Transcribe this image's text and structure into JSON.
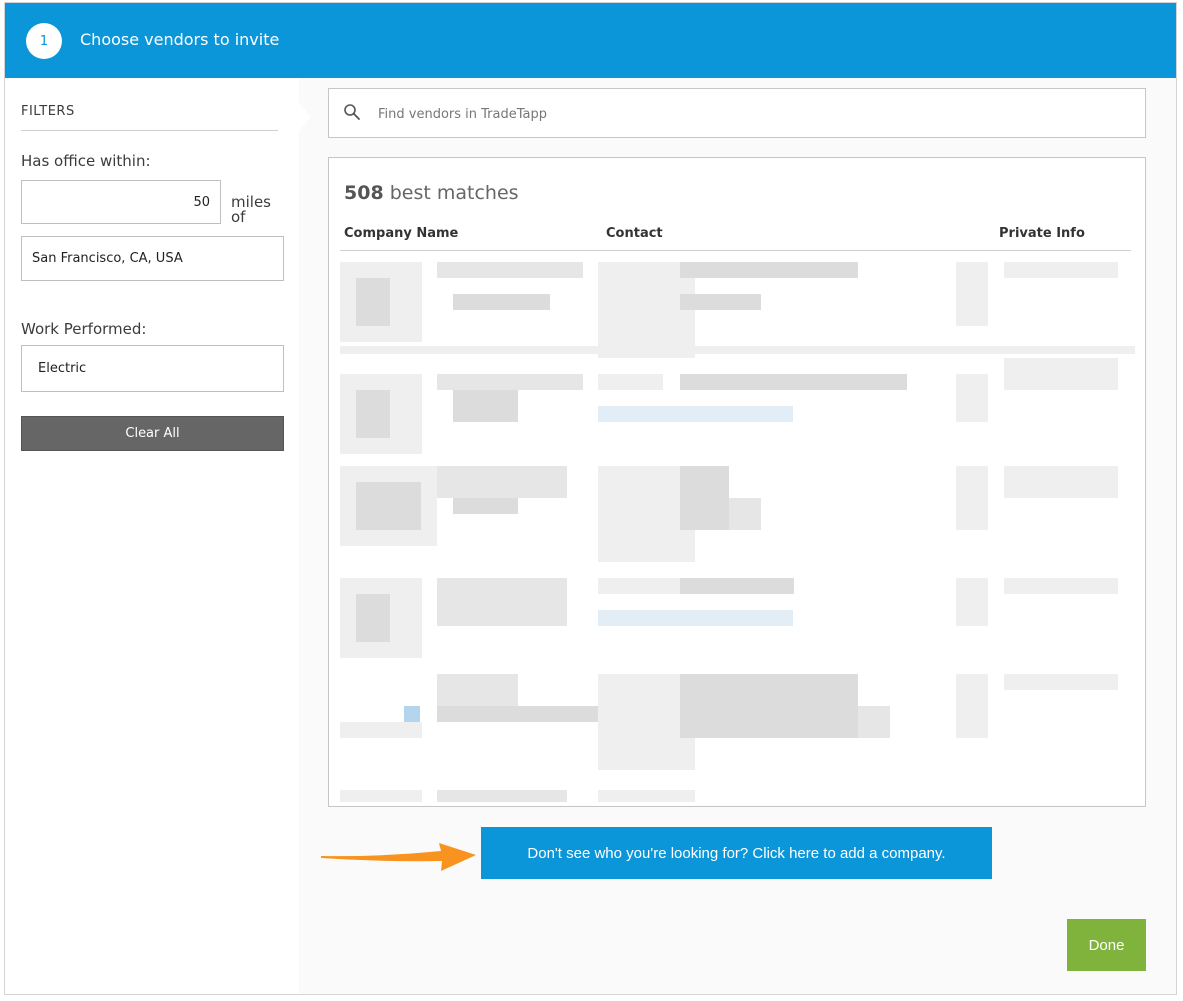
{
  "header": {
    "step_number": "1",
    "title": "Choose vendors to invite"
  },
  "filters": {
    "title": "FILTERS",
    "office_label": "Has office within:",
    "distance_value": "50",
    "distance_unit": "miles of",
    "location_value": "San Francisco, CA, USA",
    "work_label": "Work Performed:",
    "work_value": "Electric",
    "clear_label": "Clear All"
  },
  "search": {
    "placeholder": "Find vendors in TradeTapp",
    "icon": "search-icon"
  },
  "results": {
    "count": "508",
    "count_suffix": "best matches",
    "columns": [
      "Company Name",
      "Contact",
      "Private Info"
    ],
    "rows_blurred": true
  },
  "actions": {
    "add_company_label": "Don't see who you're looking for? Click here to add a company.",
    "done_label": "Done"
  },
  "colors": {
    "header": "#0a96d8",
    "add_button": "#0a96d8",
    "done_button": "#80b33c",
    "clear_button": "#666666",
    "arrow": "#f7931e"
  }
}
